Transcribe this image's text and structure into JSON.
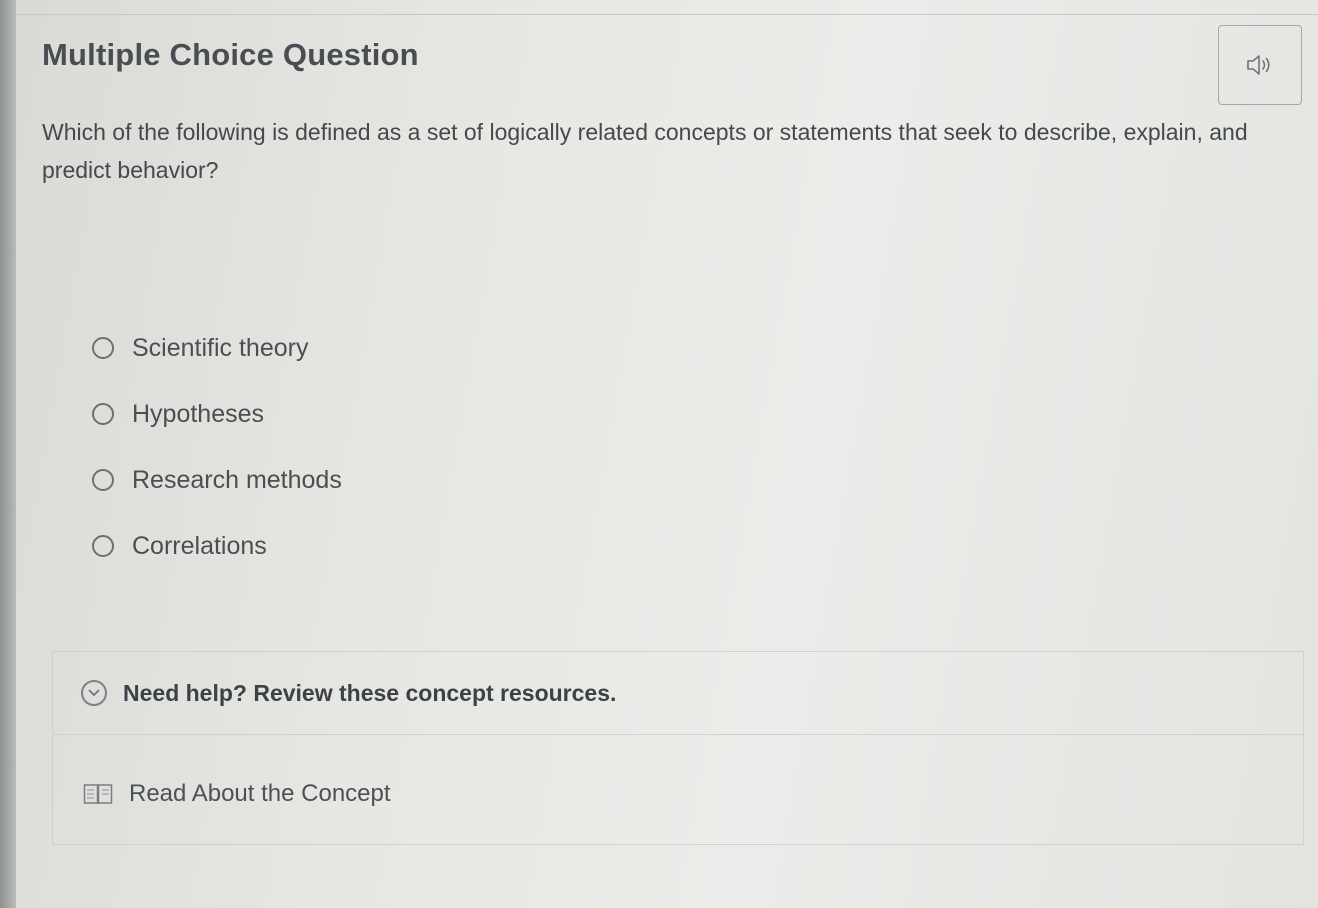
{
  "question": {
    "title": "Multiple Choice Question",
    "stem": "Which of the following is defined as a set of logically related concepts or statements that seek to describe, explain, and predict behavior?",
    "audio_icon": "speaker-icon"
  },
  "options": [
    {
      "label": "Scientific theory",
      "selected": false
    },
    {
      "label": "Hypotheses",
      "selected": false
    },
    {
      "label": "Research methods",
      "selected": false
    },
    {
      "label": "Correlations",
      "selected": false
    }
  ],
  "help": {
    "title": "Need help? Review these concept resources.",
    "toggle_icon": "chevron-down-icon",
    "resources": [
      {
        "label": "Read About the Concept",
        "icon": "book-icon"
      }
    ]
  },
  "colors": {
    "text": "#45494d",
    "border": "#cfd1ce",
    "radio": "#6c7074"
  }
}
